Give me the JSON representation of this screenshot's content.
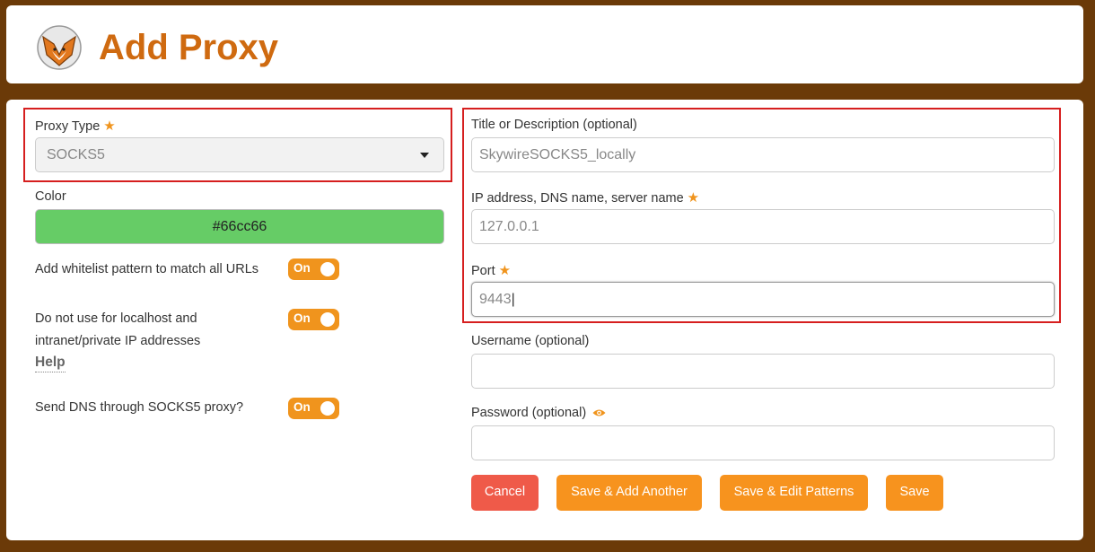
{
  "header": {
    "title": "Add Proxy",
    "logo": "fox-logo-icon"
  },
  "left": {
    "proxy_type": {
      "label": "Proxy Type",
      "value": "SOCKS5",
      "required": true
    },
    "color": {
      "label": "Color",
      "value": "#66cc66"
    },
    "whitelist": {
      "label": "Add whitelist pattern to match all URLs",
      "toggle": "On"
    },
    "localhost": {
      "label_line1": "Do not use for localhost and",
      "label_line2": "intranet/private IP addresses",
      "toggle": "On",
      "help": "Help"
    },
    "dns": {
      "label": "Send DNS through SOCKS5 proxy?",
      "toggle": "On"
    }
  },
  "right": {
    "title": {
      "label": "Title or Description (optional)",
      "value": "SkywireSOCKS5_locally"
    },
    "address": {
      "label": "IP address, DNS name, server name",
      "value": "127.0.0.1",
      "required": true
    },
    "port": {
      "label": "Port",
      "value": "9443",
      "required": true
    },
    "username": {
      "label": "Username (optional)",
      "value": ""
    },
    "password": {
      "label": "Password (optional)",
      "value": "",
      "icon": "eye-icon"
    }
  },
  "buttons": {
    "cancel": "Cancel",
    "save_add_another": "Save & Add Another",
    "save_edit_patterns": "Save & Edit Patterns",
    "save": "Save"
  },
  "colors": {
    "accent": "#f7931e",
    "title": "#cf6a10",
    "cancel": "#ef5a49",
    "background": "#6b3a08",
    "highlight": "#d61f1f"
  }
}
